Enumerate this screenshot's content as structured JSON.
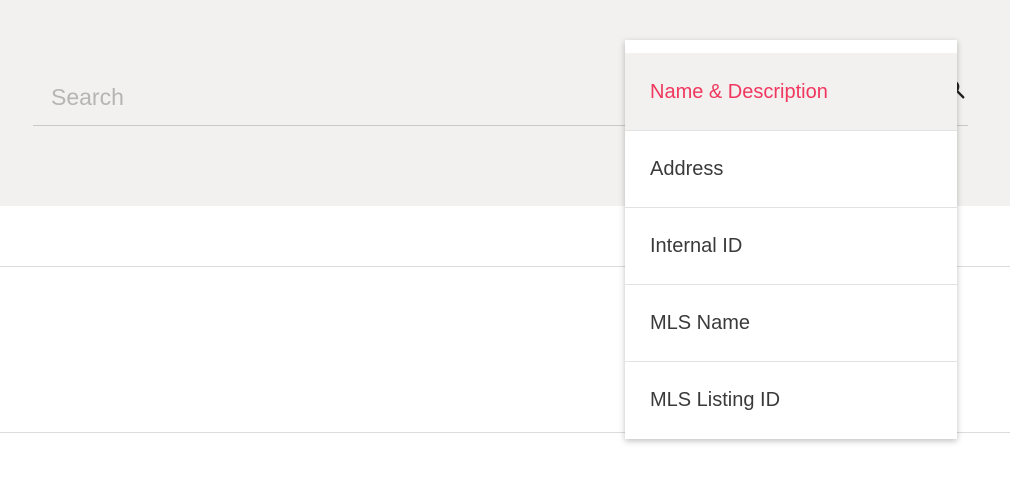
{
  "search": {
    "placeholder": "Search",
    "value": ""
  },
  "search_field": {
    "options": [
      "Name & Description",
      "Address",
      "Internal ID",
      "MLS Name",
      "MLS Listing ID"
    ],
    "selected": "Name & Description"
  },
  "colors": {
    "accent": "#f0375e",
    "panel_background": "#f2f1f0",
    "text": "#3a3a3a",
    "placeholder": "#b5b5b5"
  },
  "icons": {
    "search": "search-icon"
  }
}
